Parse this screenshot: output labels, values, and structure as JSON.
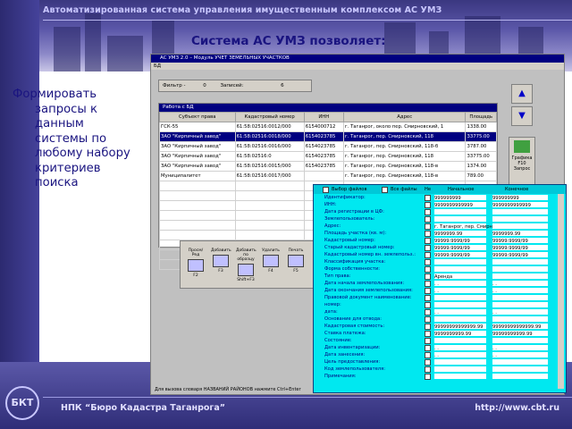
{
  "header": {
    "title": "Автоматизированная система управления имущественным комплексом АС УМЗ"
  },
  "slide": {
    "heading": "Система АС УМЗ позволяет:",
    "bullet_lines": [
      "Формировать",
      "запросы к",
      "данным",
      "системы по",
      "любому набору",
      "критериев",
      "поиска"
    ]
  },
  "footer": {
    "company": "НПК “Бюро Кадастра Таганрога”",
    "url": "http://www.cbt.ru",
    "logo_text": "БКТ"
  },
  "app": {
    "title": "АС УМЗ 2.0 – Модуль УЧЕТ ЗЕМЕЛЬНЫХ УЧАСТКОВ",
    "filter_label": "Фильтр -",
    "filter_count": "0",
    "records_label": "Записей:",
    "records_count": "6",
    "table_window_title": "Работа с БД",
    "columns": [
      "Субъект права",
      "Кадастровый номер",
      "ИНН",
      "Адрес",
      "Площадь"
    ],
    "rows": [
      [
        "ГСК-55",
        "61:58:02516:0012/000",
        "6154000712",
        "г. Таганрог, около пер. Смирновский, 1",
        "1338.00"
      ],
      [
        "ЗАО \"Кирпичный завод\"",
        "61:58:02516:0018/000",
        "6154023785",
        "г. Таганрог, пер. Смирновский, 118",
        "33775.00"
      ],
      [
        "ЗАО \"Кирпичный завод\"",
        "61:58:02516:0016/000",
        "6154023785",
        "г. Таганрог, пер. Смирновский, 118-б",
        "3787.00"
      ],
      [
        "ЗАО \"Кирпичный завод\"",
        "61:58:02516:0",
        "6154023785",
        "г. Таганрог, пер. Смирновский, 118",
        "33775.00"
      ],
      [
        "ЗАО \"Кирпичный завод\"",
        "61:58:02516:0015/000",
        "6154023785",
        "г. Таганрог, пер. Смирновский, 118-в",
        "1374.00"
      ],
      [
        "Муниципалитет",
        "61:58:02516:0017/000",
        "",
        "г. Таганрог, пер. Смирновский, 118-в",
        "789.00"
      ]
    ],
    "selected_row": 1,
    "toolbar_buttons": [
      {
        "label": "Просм/Ред",
        "key": "F2"
      },
      {
        "label": "Добавить",
        "key": "F3"
      },
      {
        "label": "Добавить по образцу",
        "key": "Shift+F3"
      },
      {
        "label": "Удалить",
        "key": "F4"
      },
      {
        "label": "Печать",
        "key": "F5"
      }
    ],
    "right_button": {
      "label": "Графика",
      "key": "F10",
      "sub": "Запрос"
    },
    "status": "Для вызова словаря НАЗВАНИЙ РАЙОНОВ нажмите Ctrl+Enter"
  },
  "query": {
    "select_file_label": "Выбор файлов",
    "all_files_label": "Все файлы",
    "col_no": "Не",
    "col_start": "Начальное",
    "col_end": "Конечное",
    "fields": [
      {
        "label": "Идентификатор:",
        "v1": "999999999",
        "v2": "999999999"
      },
      {
        "label": "ИНН:",
        "v1": "9999999999999",
        "v2": "9999999999999"
      },
      {
        "label": "Дата регистрации в ЦФ:",
        "v1": "",
        "v2": ""
      },
      {
        "label": "Землепользователь:",
        "v1": "",
        "v2": ""
      },
      {
        "label": "Адрес:",
        "v1": "г. Таганрог, пер. Смирновский, 118",
        "v2": ""
      },
      {
        "label": "Площадь участка (кв. м):",
        "v1": "9999999.99",
        "v2": "9999999.99"
      },
      {
        "label": "Кадастровый номер:",
        "v1": "99999:9999/99",
        "v2": "99999:9999/99"
      },
      {
        "label": "Старый кадастровый номер:",
        "v1": "99999:9999/99",
        "v2": "99999:9999/99"
      },
      {
        "label": "Кадастровый номер вн. землепольз.:",
        "v1": "99999:9999/99",
        "v2": "99999:9999/99"
      },
      {
        "label": "Классификация участка:",
        "v1": "",
        "v2": ""
      },
      {
        "label": "Форма собственности:",
        "v1": "",
        "v2": ""
      },
      {
        "label": "Тип права:",
        "v1": "Аренда",
        "v2": ""
      },
      {
        "label": "Дата начала землепользования:",
        "v1": ". .",
        "v2": ". ."
      },
      {
        "label": "Дата окончания землепользования:",
        "v1": ". .",
        "v2": ". ."
      },
      {
        "label": "Правовой документ наименование:",
        "v1": "",
        "v2": ""
      },
      {
        "label": "номер:",
        "v1": "",
        "v2": ""
      },
      {
        "label": "дата:",
        "v1": ". .",
        "v2": ". ."
      },
      {
        "label": "Основание для отвода:",
        "v1": "",
        "v2": ""
      },
      {
        "label": "Кадастровая стоимость:",
        "v1": "99999999999999.99",
        "v2": "99999999999999.99"
      },
      {
        "label": "Ставка платежа:",
        "v1": "9999999999.99",
        "v2": "99999999999.99"
      },
      {
        "label": "Состояние:",
        "v1": "",
        "v2": ""
      },
      {
        "label": "Дата инвентаризации:",
        "v1": ". .",
        "v2": ". ."
      },
      {
        "label": "Дата занесения:",
        "v1": ". .",
        "v2": ". ."
      },
      {
        "label": "Цель предоставления:",
        "v1": "",
        "v2": ""
      },
      {
        "label": "Код землепользователя:",
        "v1": "",
        "v2": ""
      },
      {
        "label": "Примечания:",
        "v1": "",
        "v2": ""
      }
    ]
  }
}
